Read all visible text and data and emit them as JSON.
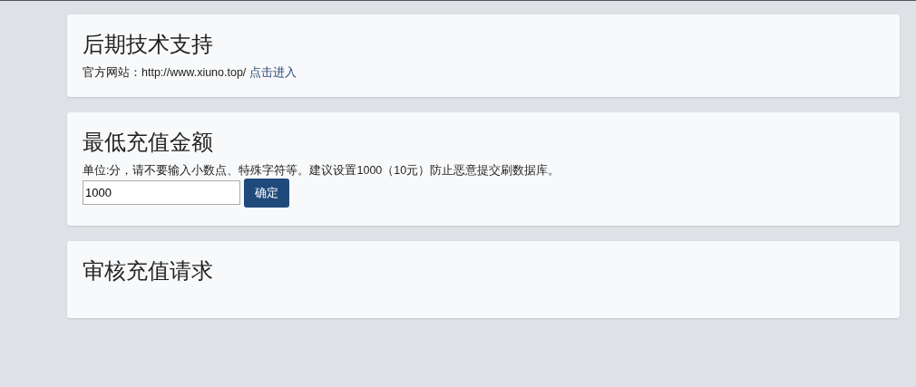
{
  "sections": [
    {
      "kind": "link",
      "title": "后期技术支持",
      "label": "官方网站：",
      "url": "http://www.xiuno.top/",
      "link": "点击进入"
    },
    {
      "kind": "form",
      "title": "最低充值金额",
      "hint": "单位:分，请不要输入小数点、特殊字符等。建议设置1000（10元）防止恶意提交刷数据库。",
      "value": "1000",
      "button": "确定"
    },
    {
      "kind": "empty",
      "title": "审核充值请求"
    }
  ]
}
